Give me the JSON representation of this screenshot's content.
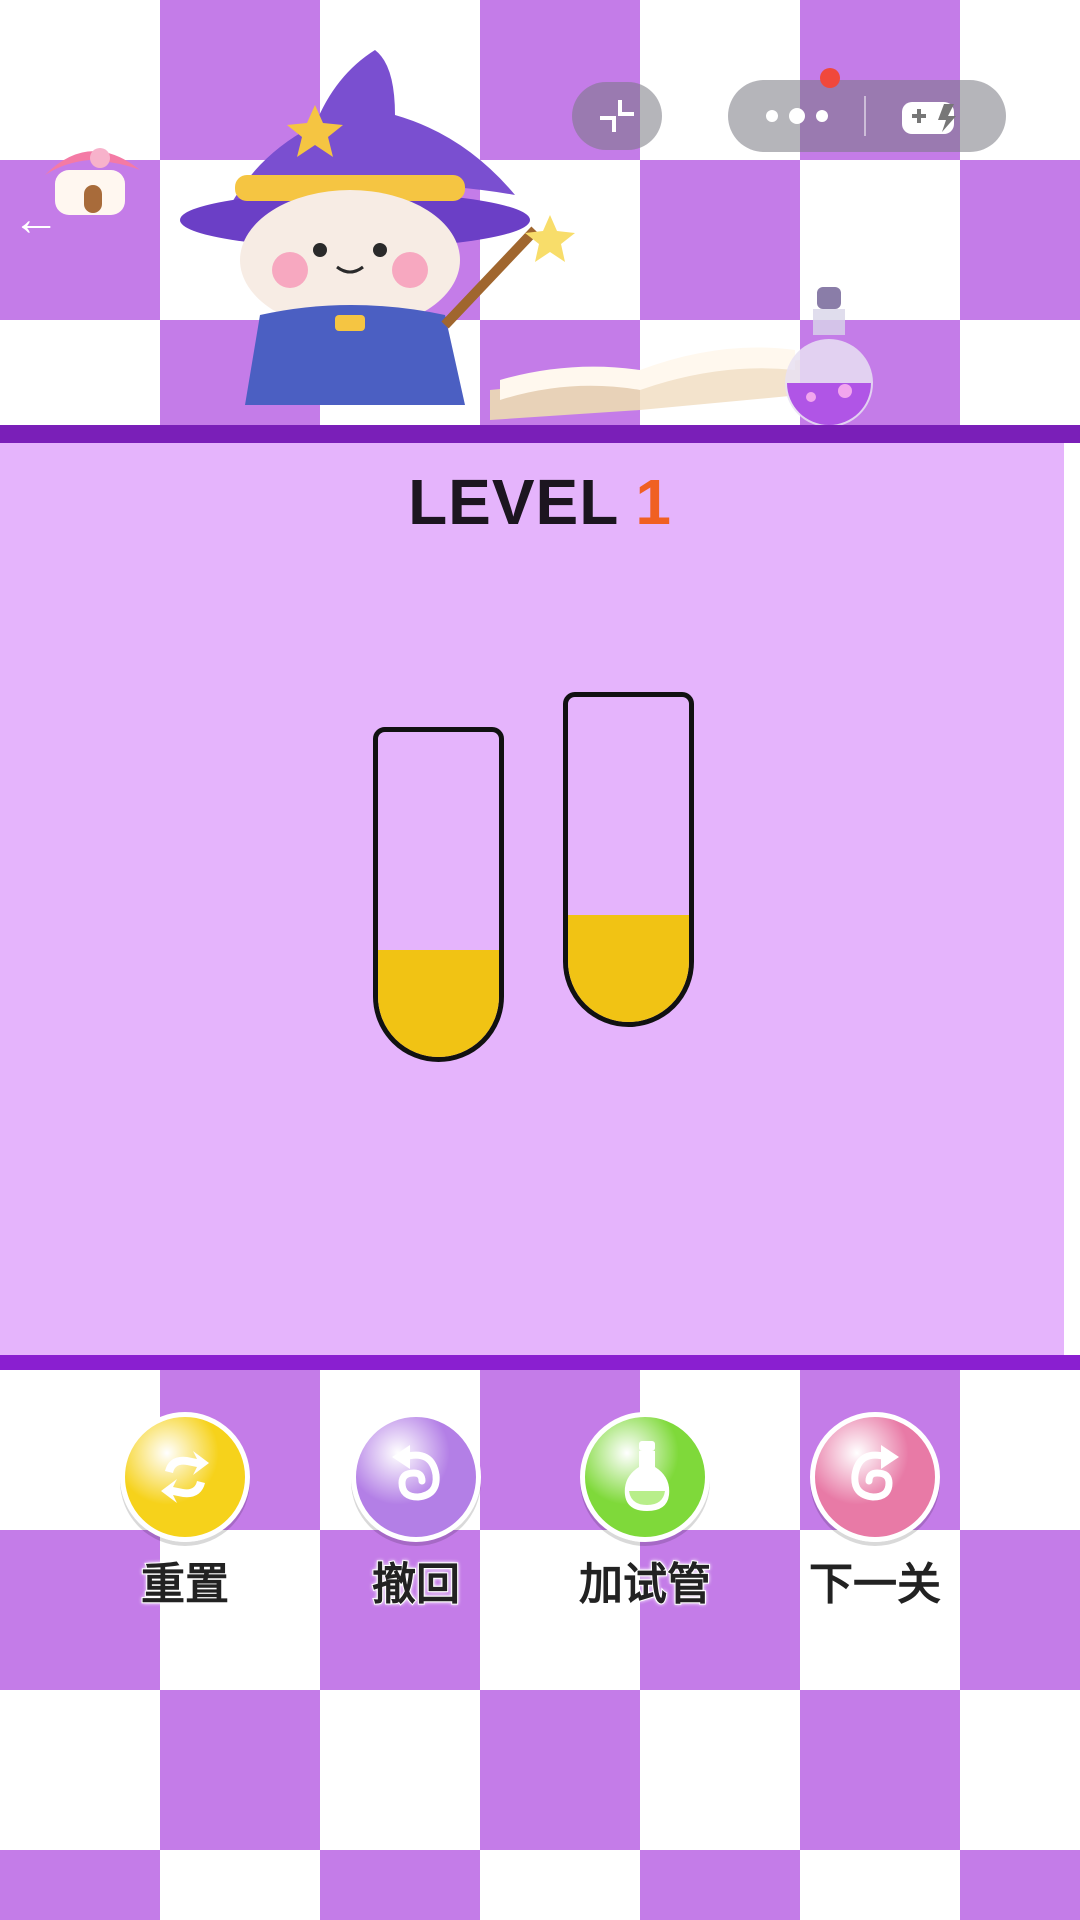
{
  "level": {
    "prefix": "LEVEL",
    "number": "1"
  },
  "tubes": [
    {
      "fill_fraction": 0.33,
      "liquid_color": "#f1c314"
    },
    {
      "fill_fraction": 0.33,
      "liquid_color": "#f1c314"
    }
  ],
  "actions": [
    {
      "label": "重置",
      "icon": "refresh-icon",
      "color": "#f6d21b"
    },
    {
      "label": "撤回",
      "icon": "undo-icon",
      "color": "#b37fe6"
    },
    {
      "label": "加试管",
      "icon": "add-tube-icon",
      "color": "#7fd93a"
    },
    {
      "label": "下一关",
      "icon": "next-level-icon",
      "color": "#e87aa6"
    }
  ],
  "colors": {
    "play_area": "#e5b4fc",
    "bar": "#7a1fb8",
    "accent": "#f06022"
  },
  "icons": {
    "back": "back-arrow-icon",
    "minimize": "minimize-icon",
    "more": "more-dots-icon",
    "gamepad": "gamepad-icon"
  }
}
